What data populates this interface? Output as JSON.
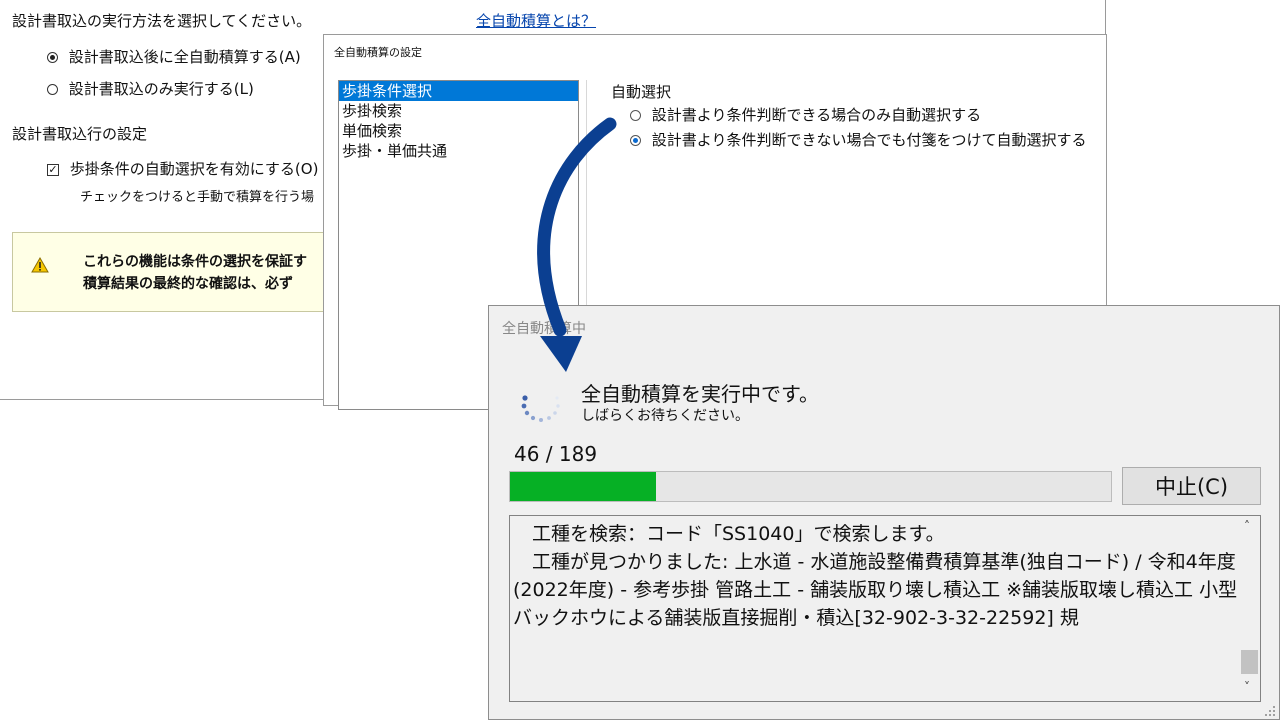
{
  "import_window": {
    "prompt": "設計書取込の実行方法を選択してください。",
    "help_link": "全自動積算とは？",
    "option_a": "設計書取込後に全自動積算する(A)",
    "option_l": "設計書取込のみ実行する(L)",
    "section_title": "設計書取込行の設定",
    "checkbox_label": "歩掛条件の自動選択を有効にする(O)",
    "checkbox_note": "チェックをつけると手動で積算を行う場",
    "warning_line1": "これらの機能は条件の選択を保証す",
    "warning_line2": "積算結果の最終的な確認は、必ず"
  },
  "settings_window": {
    "title": "全自動積算の設定",
    "list_items": [
      "歩掛条件選択",
      "歩掛検索",
      "単価検索",
      "歩掛・単価共通"
    ],
    "group_title": "自動選択",
    "radio1": "設計書より条件判断できる場合のみ自動選択する",
    "radio2": "設計書より条件判断できない場合でも付箋をつけて自動選択する"
  },
  "progress_window": {
    "title": "全自動積算中",
    "main_message": "全自動積算を実行中です。",
    "sub_message": "しばらくお待ちください。",
    "counter": "46 / 189",
    "progress": 0.243,
    "stop_button": "中止(C)",
    "log_lines": [
      "　工種を検索：コード「SS1040」で検索します。",
      "　工種が見つかりました: 上水道 - 水道施設整備費積算基準(独自コード) / 令和4年度(2022年度) - 参考歩掛 管路土工 - 舗装版取り壊し積込工 ※舗装版取壊し積込工 小型バックホウによる舗装版直接掘削・積込[32-902-3-32-22592] 規"
    ]
  },
  "colors": {
    "accent_arrow": "#0b3f91",
    "progress_fill": "#06b025",
    "selection": "#0078d7",
    "link": "#0645ad"
  }
}
